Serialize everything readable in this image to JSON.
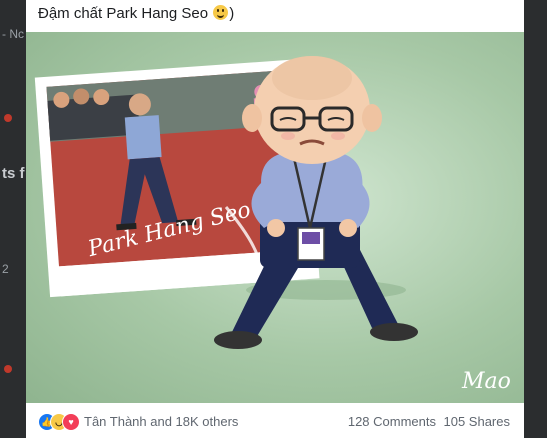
{
  "post": {
    "text": "Đậm chất Park Hang Seo",
    "text_close": ")",
    "emoji": "slightly-smiling-face"
  },
  "image": {
    "signature_text": "Park Hang Seo",
    "artist_signature": "Mao"
  },
  "footer": {
    "reaction_icons": [
      "like-icon",
      "haha-icon",
      "love-icon"
    ],
    "reaction_names": "Tân Thành and 18K others",
    "comments": "128 Comments",
    "shares": "105 Shares"
  },
  "background": {
    "left_text_1": "- Nc",
    "left_text_2": "ts f",
    "left_text_3": "2"
  },
  "colors": {
    "like": "#1877f2",
    "love": "#f33e58",
    "haha": "#f7c948",
    "photo_bg": "#a7c8a6"
  }
}
